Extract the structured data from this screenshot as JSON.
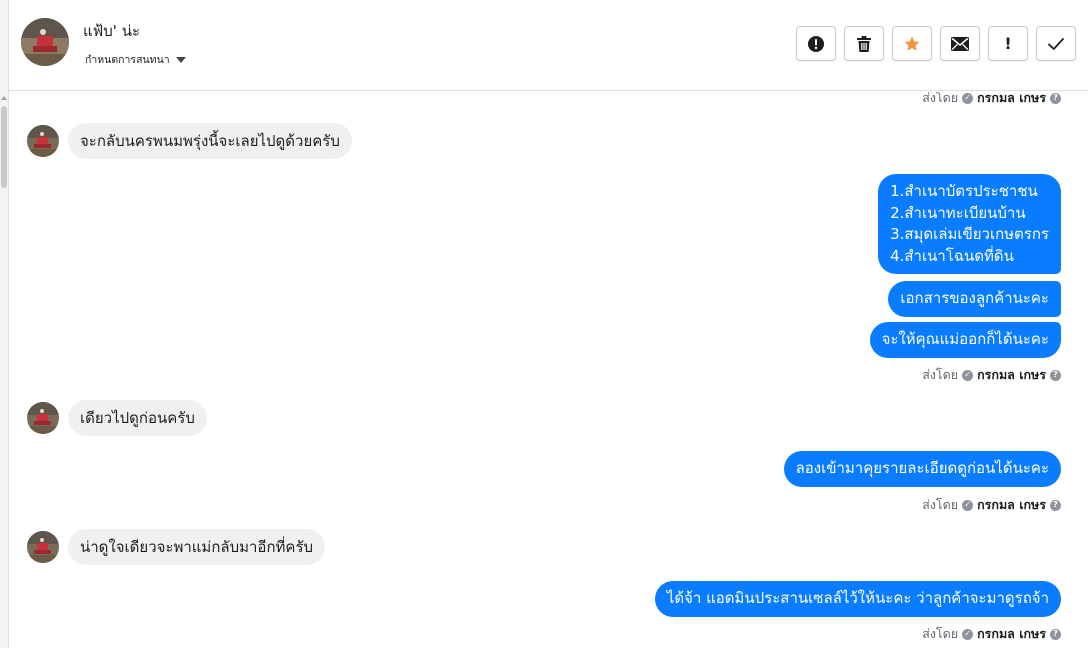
{
  "conversation": {
    "name": "แฟ้บ' น่ะ",
    "assign_label": "กำหนดการสนทนา"
  },
  "actions": [
    {
      "name": "report-spam",
      "icon": "alert-circle-icon"
    },
    {
      "name": "delete",
      "icon": "trash-icon"
    },
    {
      "name": "star",
      "icon": "star-icon",
      "color": "#f0953b"
    },
    {
      "name": "mark-unread",
      "icon": "envelope-icon"
    },
    {
      "name": "follow-up",
      "icon": "exclamation-icon",
      "text": "!"
    },
    {
      "name": "mark-done",
      "icon": "checkmark-icon"
    }
  ],
  "sent_by": {
    "prefix": "ส่งโดย",
    "agent": "กรกมล เกษร"
  },
  "messages": [
    {
      "direction": "in",
      "text": "จะกลับนครพนมพรุ่งนี้จะเลยไปดูด้วยครับ"
    },
    {
      "direction": "out",
      "lines": [
        "1.สำเนาบัตรประชาชน",
        "2.สำเนาทะเบียนบ้าน",
        "3.สมุดเล่มเขียวเกษตรกร",
        "4.สำเนาโฉนดที่ดิน"
      ]
    },
    {
      "direction": "out",
      "text": "เอกสารของลูกค้านะคะ"
    },
    {
      "direction": "out",
      "text": "จะให้คุณแม่ออกก็ได้นะคะ"
    },
    {
      "direction": "in",
      "text": "เดียวไปดูก่อนครับ"
    },
    {
      "direction": "out",
      "text": "ลองเข้ามาคุยรายละเอียดดูก่อนได้นะคะ"
    },
    {
      "direction": "in",
      "text": "น่าดูใจเดียวจะพาแม่กลับมาอีกที่ครับ"
    },
    {
      "direction": "out",
      "text": "ได้จ้า แอดมินประสานเซลล์ไว้ให้นะคะ ว่าลูกค้าจะมาดูรถจ้า"
    }
  ],
  "colors": {
    "outgoing_bubble": "#0a7cff",
    "incoming_bubble": "#f1f0f0",
    "star": "#f0953b"
  }
}
